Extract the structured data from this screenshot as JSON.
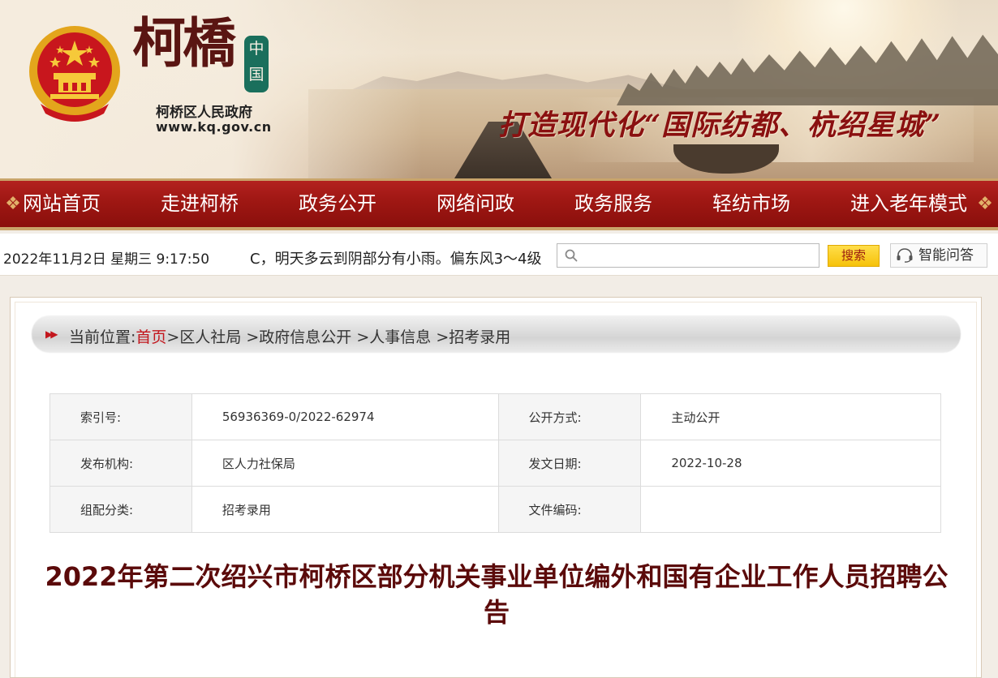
{
  "header": {
    "logo_text": "柯橋",
    "china_seal": "中国",
    "gov_name": "柯桥区人民政府",
    "gov_url": "www.kq.gov.cn",
    "slogan": "打造现代化“国际纺都、杭绍星城”"
  },
  "nav": {
    "items": [
      {
        "label": "网站首页"
      },
      {
        "label": "走进柯桥"
      },
      {
        "label": "政务公开"
      },
      {
        "label": "网络问政"
      },
      {
        "label": "政务服务"
      },
      {
        "label": "轻纺市场"
      },
      {
        "label": "进入老年模式"
      }
    ]
  },
  "util": {
    "datetime": "2022年11月2日 星期三 9:17:50",
    "weather": "C，明天多云到阴部分有小雨。偏东风3～4级",
    "search_placeholder": "",
    "search_label": "搜索",
    "qa_label": "智能问答"
  },
  "breadcrumb": {
    "prefix": "当前位置:",
    "home": "首页",
    "items": [
      ">区人社局",
      " >政府信息公开",
      " >人事信息",
      " >招考录用"
    ]
  },
  "meta": {
    "rows": [
      {
        "k1": "索引号:",
        "v1": "56936369-0/2022-62974",
        "k2": "公开方式:",
        "v2": "主动公开"
      },
      {
        "k1": "发布机构:",
        "v1": "区人力社保局",
        "k2": "发文日期:",
        "v2": "2022-10-28"
      },
      {
        "k1": "组配分类:",
        "v1": "招考录用",
        "k2": "文件编码:",
        "v2": ""
      }
    ]
  },
  "article": {
    "title": "2022年第二次绍兴市柯桥区部分机关事业单位编外和国有企业工作人员招聘公告"
  },
  "colors": {
    "nav_red": "#9e1713",
    "title_red": "#5b0a0a",
    "crumb_home": "#c3161d",
    "search_yellow": "#f6c20a"
  }
}
